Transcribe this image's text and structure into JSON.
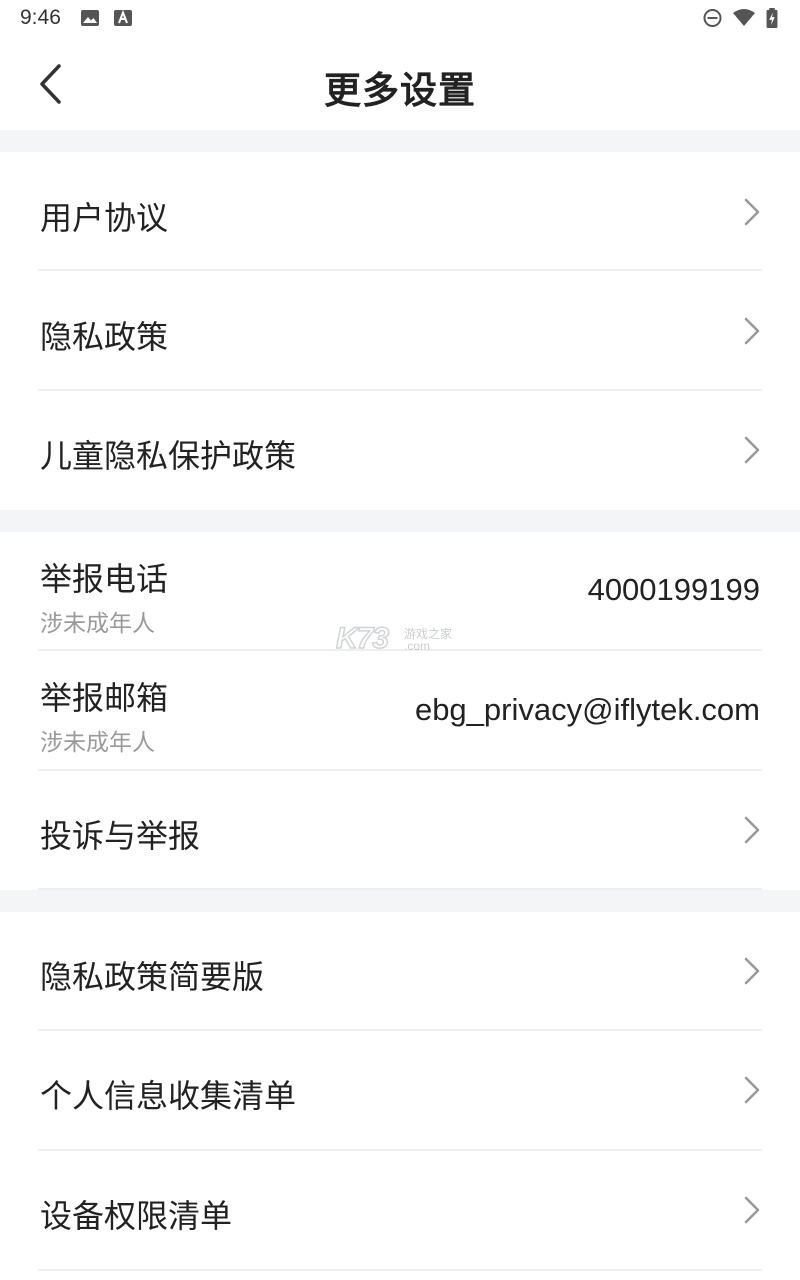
{
  "status_bar": {
    "time": "9:46"
  },
  "header": {
    "title": "更多设置"
  },
  "watermark": {
    "logo": "K73",
    "tagline": "游戏之家",
    "domain": ".com"
  },
  "sections": [
    {
      "items": [
        {
          "label": "用户协议"
        },
        {
          "label": "隐私政策"
        },
        {
          "label": "儿童隐私保护政策"
        }
      ]
    },
    {
      "items": [
        {
          "label": "举报电话",
          "sub": "涉未成年人",
          "value": "4000199199"
        },
        {
          "label": "举报邮箱",
          "sub": "涉未成年人",
          "value": "ebg_privacy@iflytek.com"
        },
        {
          "label": "投诉与举报"
        }
      ]
    },
    {
      "items": [
        {
          "label": "隐私政策简要版"
        },
        {
          "label": "个人信息收集清单"
        },
        {
          "label": "设备权限清单"
        }
      ]
    }
  ],
  "icons": {
    "back": "chevron-left-icon",
    "row_arrow": "chevron-right-icon",
    "status_left": [
      "image-icon",
      "font-icon"
    ],
    "status_right": [
      "do-not-disturb-icon",
      "wifi-icon",
      "battery-charging-icon"
    ]
  },
  "colors": {
    "background": "#ffffff",
    "section_gap": "#f4f5f7",
    "divider": "#eeeeee",
    "text_primary": "#222222",
    "text_secondary": "#9a9a9a",
    "chevron": "#999999"
  }
}
